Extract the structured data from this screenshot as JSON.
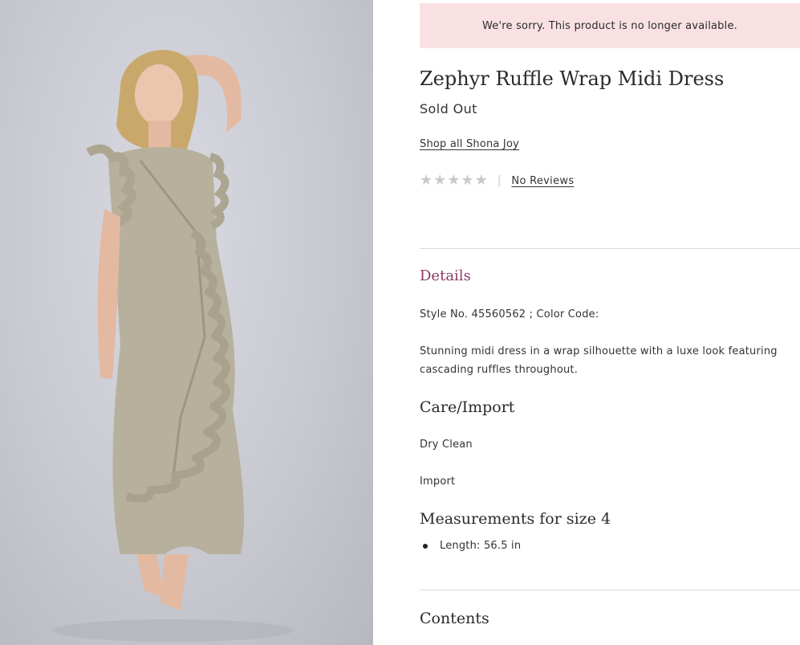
{
  "product_image": {
    "alt": "Model wearing a sage ruffle wrap midi dress"
  },
  "alert": {
    "message": "We're sorry. This product is no longer available."
  },
  "product": {
    "title": "Zephyr Ruffle Wrap Midi Dress",
    "availability": "Sold Out",
    "brand_link": "Shop all Shona Joy"
  },
  "rating": {
    "stars": 0,
    "max_stars": 5,
    "reviews_link": "No Reviews"
  },
  "details": {
    "heading": "Details",
    "style_line": "Style No. 45560562 ; Color Code:",
    "description": "Stunning midi dress in a wrap silhouette with a luxe look featuring cascading ruffles throughout."
  },
  "care": {
    "heading": "Care/Import",
    "care": "Dry Clean",
    "import": "Import"
  },
  "measurements": {
    "heading": "Measurements for size 4",
    "items": [
      "Length: 56.5 in"
    ]
  },
  "contents": {
    "heading": "Contents"
  },
  "colors": {
    "alert_bg": "#f9e1e3",
    "details_heading": "#8c3a66",
    "star_empty": "#c9c9c9"
  }
}
